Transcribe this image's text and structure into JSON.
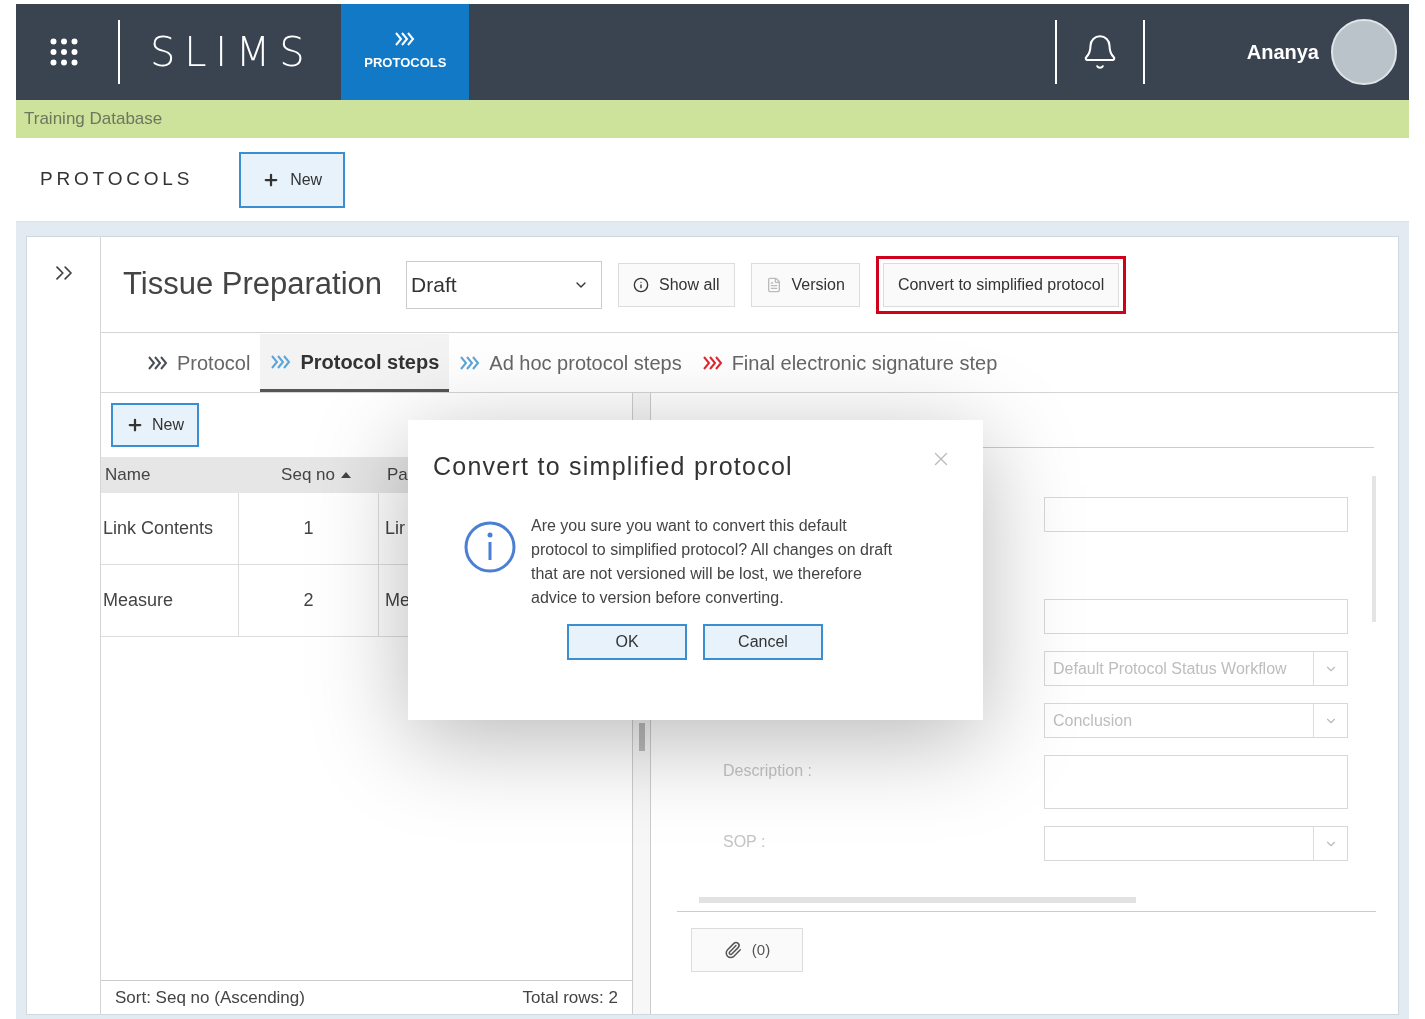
{
  "header": {
    "app_name": "SLIMS",
    "module": "PROTOCOLS",
    "user": "Ananya"
  },
  "database_banner": "Training Database",
  "page": {
    "title": "PROTOCOLS",
    "new_button": "New"
  },
  "protocol": {
    "title": "Tissue Preparation",
    "status": "Draft",
    "buttons": [
      {
        "label": "Show all",
        "kind": "info",
        "highlighted": false
      },
      {
        "label": "Version",
        "kind": "version",
        "highlighted": false
      },
      {
        "label": "Convert to simplified protocol",
        "kind": "plain",
        "highlighted": true
      }
    ]
  },
  "tabs": [
    {
      "label": "Protocol",
      "selected": false,
      "color": "#4a4f57"
    },
    {
      "label": "Protocol steps",
      "selected": true,
      "color": "#5ba4d9"
    },
    {
      "label": "Ad hoc protocol steps",
      "selected": false,
      "color": "#5ba4d9"
    },
    {
      "label": "Final electronic signature step",
      "selected": false,
      "color": "#e0262f"
    }
  ],
  "steps": {
    "new_button": "New",
    "columns": [
      {
        "label": "Name",
        "sorted": false
      },
      {
        "label": "Seq no",
        "sorted": true
      },
      {
        "label": "Pa",
        "sorted": false
      }
    ],
    "rows": [
      [
        "Link Contents",
        "1",
        "Lir"
      ],
      [
        "Measure",
        "2",
        "Me"
      ]
    ],
    "sort_info": "Sort: Seq no (Ascending)",
    "total_rows": "Total rows: 2"
  },
  "form": {
    "fields": [
      {
        "kind": "text"
      },
      {
        "kind": "text"
      },
      {
        "kind": "select",
        "value": "Default Protocol Status Workflow"
      },
      {
        "kind": "select",
        "value": "Conclusion"
      },
      {
        "kind": "textarea",
        "label": "Description :"
      },
      {
        "kind": "select",
        "label": "SOP :"
      }
    ],
    "attachments": "(0)"
  },
  "dialog": {
    "title": "Convert to simplified protocol",
    "message": "Are you sure you want to convert this default protocol to simplified protocol? All changes on draft that are not versioned will be lost, we therefore advice to version before converting.",
    "buttons": [
      "OK",
      "Cancel"
    ]
  }
}
